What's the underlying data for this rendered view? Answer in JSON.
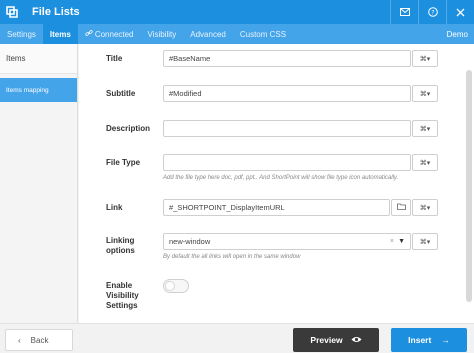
{
  "app": {
    "title": "File Lists"
  },
  "header_icons": [
    "mail-icon",
    "help-icon",
    "close-icon"
  ],
  "tabs": [
    {
      "label": "Settings",
      "active": false
    },
    {
      "label": "Items",
      "active": true
    },
    {
      "label": "Connected",
      "active": false,
      "icon": "link-icon"
    },
    {
      "label": "Visibility",
      "active": false
    },
    {
      "label": "Advanced",
      "active": false
    },
    {
      "label": "Custom CSS",
      "active": false
    }
  ],
  "tab_right": "Demo",
  "sidebar": {
    "items": [
      {
        "label": "Items"
      },
      {
        "label": "Items mapping",
        "active": true
      }
    ]
  },
  "form": {
    "title": {
      "label": "Title",
      "value": "#BaseName"
    },
    "subtitle": {
      "label": "Subtitle",
      "value": "#Modified"
    },
    "description": {
      "label": "Description",
      "value": ""
    },
    "file_type": {
      "label": "File Type",
      "value": "",
      "hint": "Add the file type here doc, pdf, ppt.. And ShortPoint will show file type icon automatically."
    },
    "link": {
      "label": "Link",
      "value": "#_SHORTPOINT_DisplayItemURL"
    },
    "linking_options": {
      "label_line1": "Linking",
      "label_line2": "options",
      "value": "new-window",
      "hint": "By default the all links will open in the same window"
    },
    "visibility": {
      "label_line1": "Enable",
      "label_line2": "Visibility",
      "label_line3": "Settings",
      "enabled": false
    }
  },
  "footer": {
    "back_label": "Back",
    "preview_label": "Preview",
    "insert_label": "Insert"
  },
  "colors": {
    "primary": "#1c8fdf",
    "tabbar": "#44a4ea",
    "preview": "#3a3a3a"
  }
}
